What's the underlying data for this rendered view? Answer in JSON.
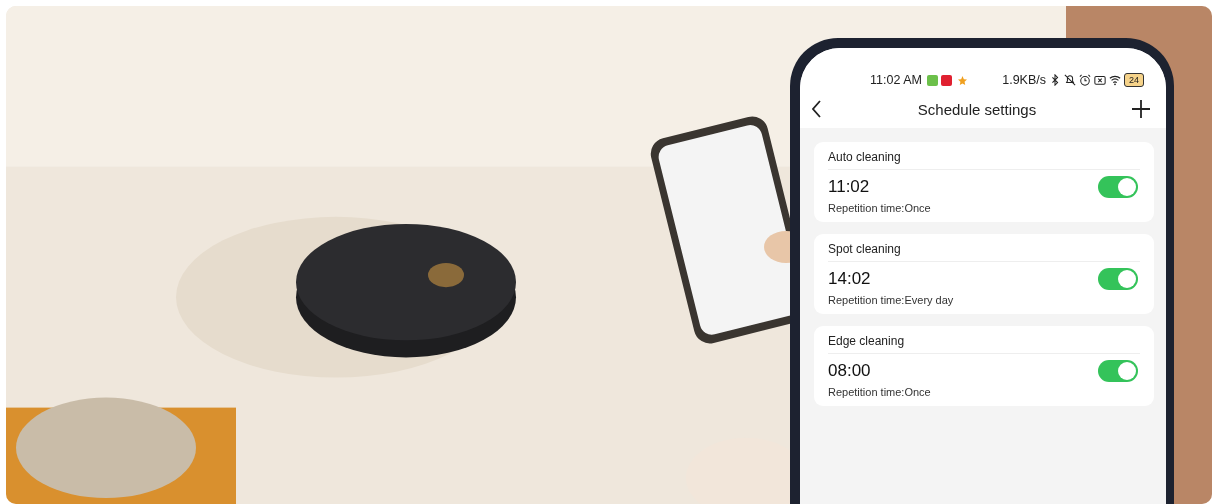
{
  "status_bar": {
    "time": "11:02 AM",
    "speed": "1.9KB/s",
    "battery": "24"
  },
  "header": {
    "title": "Schedule settings"
  },
  "schedules": [
    {
      "name": "Auto cleaning",
      "time": "11:02",
      "repetition": "Repetition time:Once",
      "on": true
    },
    {
      "name": "Spot cleaning",
      "time": "14:02",
      "repetition": "Repetition time:Every day",
      "on": true
    },
    {
      "name": "Edge cleaning",
      "time": "08:00",
      "repetition": "Repetition time:Once",
      "on": true
    }
  ]
}
